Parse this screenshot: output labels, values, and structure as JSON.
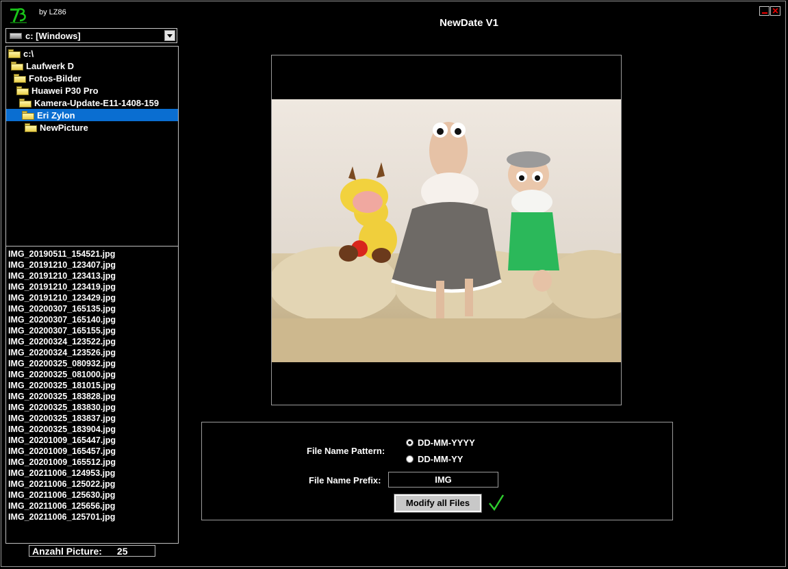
{
  "app": {
    "title": "NewDate V1",
    "byline": "by LZ86"
  },
  "drive_select": {
    "value": "c: [Windows]"
  },
  "folder_tree": [
    {
      "label": "c:\\"
    },
    {
      "label": "Laufwerk  D"
    },
    {
      "label": "Fotos-Bilder"
    },
    {
      "label": "Huawei P30 Pro"
    },
    {
      "label": "Kamera-Update-E11-1408-159"
    },
    {
      "label": "Eri Zylon",
      "selected": true
    },
    {
      "label": "NewPicture"
    }
  ],
  "files": [
    "IMG_20190511_154521.jpg",
    "IMG_20191210_123407.jpg",
    "IMG_20191210_123413.jpg",
    "IMG_20191210_123419.jpg",
    "IMG_20191210_123429.jpg",
    "IMG_20200307_165135.jpg",
    "IMG_20200307_165140.jpg",
    "IMG_20200307_165155.jpg",
    "IMG_20200324_123522.jpg",
    "IMG_20200324_123526.jpg",
    "IMG_20200325_080932.jpg",
    "IMG_20200325_081000.jpg",
    "IMG_20200325_181015.jpg",
    "IMG_20200325_183828.jpg",
    "IMG_20200325_183830.jpg",
    "IMG_20200325_183837.jpg",
    "IMG_20200325_183904.jpg",
    "IMG_20201009_165447.jpg",
    "IMG_20201009_165457.jpg",
    "IMG_20201009_165512.jpg",
    "IMG_20211006_124953.jpg",
    "IMG_20211006_125022.jpg",
    "IMG_20211006_125630.jpg",
    "IMG_20211006_125656.jpg",
    "IMG_20211006_125701.jpg"
  ],
  "counter": {
    "label": "Anzahl Picture:",
    "value": "25"
  },
  "options": {
    "pattern_label": "File Name Pattern:",
    "patterns": [
      {
        "label": "DD-MM-YYYY",
        "checked": true
      },
      {
        "label": "DD-MM-YY",
        "checked": false
      }
    ],
    "prefix_label": "File Name Prefix:",
    "prefix_value": "IMG",
    "modify_button": "Modify all Files"
  },
  "colors": {
    "selection": "#0a6ed1",
    "check": "#2ecc2e",
    "close": "#e00000"
  }
}
